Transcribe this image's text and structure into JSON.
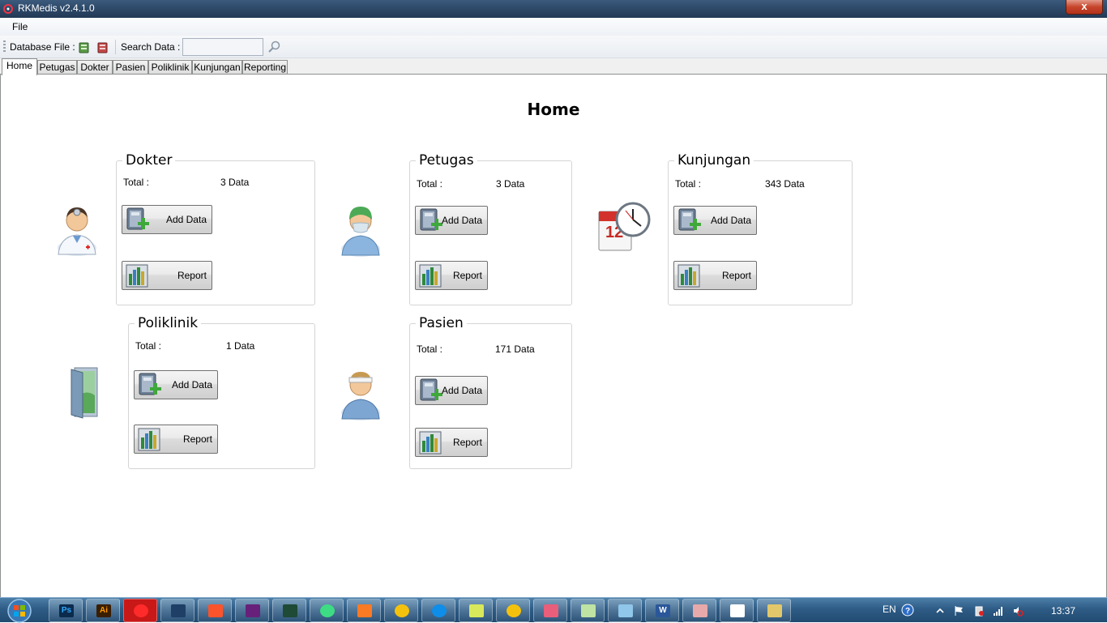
{
  "window": {
    "title": "RKMedis v2.4.1.0",
    "close_label": "x"
  },
  "menu": {
    "items": [
      "File"
    ]
  },
  "toolbar": {
    "database_label": "Database File :",
    "search_label": "Search Data :",
    "search_value": "",
    "search_placeholder": ""
  },
  "tabs": [
    "Home",
    "Petugas",
    "Dokter",
    "Pasien",
    "Poliklinik",
    "Kunjungan",
    "Reporting"
  ],
  "active_tab": "Home",
  "page": {
    "title": "Home"
  },
  "groups": {
    "dokter": {
      "title": "Dokter",
      "total_label": "Total :",
      "total_value": "3 Data",
      "add_label": "Add Data",
      "report_label": "Report",
      "icon": "doctor-icon"
    },
    "petugas": {
      "title": "Petugas",
      "total_label": "Total :",
      "total_value": "3 Data",
      "add_label": "Add Data",
      "report_label": "Report",
      "icon": "surgeon-icon"
    },
    "kunjungan": {
      "title": "Kunjungan",
      "total_label": "Total :",
      "total_value": "343 Data",
      "add_label": "Add Data",
      "report_label": "Report",
      "icon": "calendar-clock-icon"
    },
    "poliklinik": {
      "title": "Poliklinik",
      "total_label": "Total :",
      "total_value": "1 Data",
      "add_label": "Add Data",
      "report_label": "Report",
      "icon": "door-icon"
    },
    "pasien": {
      "title": "Pasien",
      "total_label": "Total :",
      "total_value": "171 Data",
      "add_label": "Add Data",
      "report_label": "Report",
      "icon": "patient-icon"
    }
  },
  "taskbar": {
    "apps": [
      "Ps",
      "Ai",
      "",
      "",
      "",
      "",
      "",
      "",
      "",
      "",
      "",
      "",
      "",
      "",
      "",
      "W",
      "",
      "",
      ""
    ],
    "language": "EN",
    "clock": "13:37"
  }
}
